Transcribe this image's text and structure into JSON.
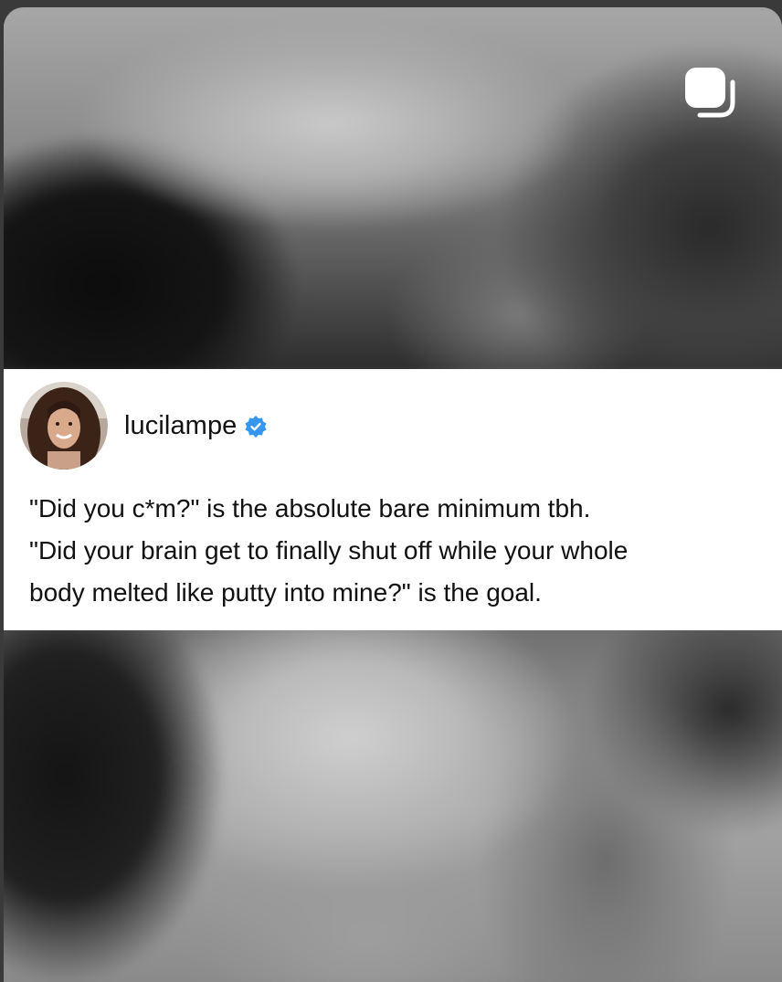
{
  "post": {
    "username": "lucilampe",
    "verified": true,
    "lines": [
      "\"Did you c*m?\" is the absolute bare minimum tbh.",
      "\"Did your brain get to finally shut off while your whole",
      "body melted like putty into mine?\" is the goal."
    ]
  },
  "icons": {
    "repost": "repost-sticker-icon",
    "verified": "verified-badge-icon",
    "avatar": "avatar"
  },
  "colors": {
    "verified_badge": "#3797f0",
    "card_background": "#ffffff",
    "text": "#111111"
  }
}
